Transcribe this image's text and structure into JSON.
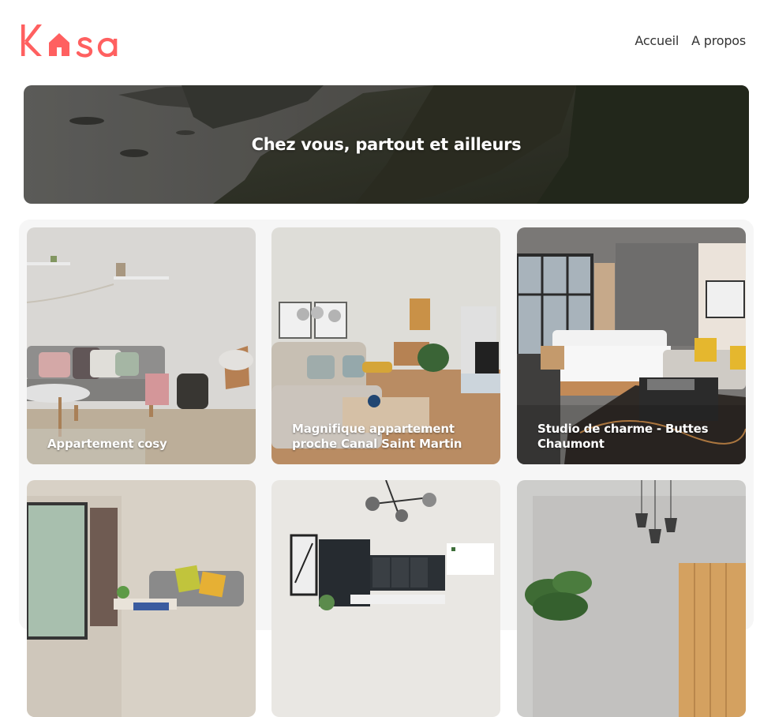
{
  "brand": {
    "logo_text": "Kasa",
    "color": "#FF6060"
  },
  "nav": {
    "items": [
      "Accueil",
      "A propos"
    ]
  },
  "banner": {
    "title": "Chez vous, partout et ailleurs"
  },
  "gallery": {
    "cards": [
      {
        "title": "Appartement cosy"
      },
      {
        "title": "Magnifique appartement proche Canal Saint Martin"
      },
      {
        "title": "Studio de charme - Buttes Chaumont"
      },
      {
        "title": ""
      },
      {
        "title": ""
      },
      {
        "title": ""
      }
    ]
  }
}
